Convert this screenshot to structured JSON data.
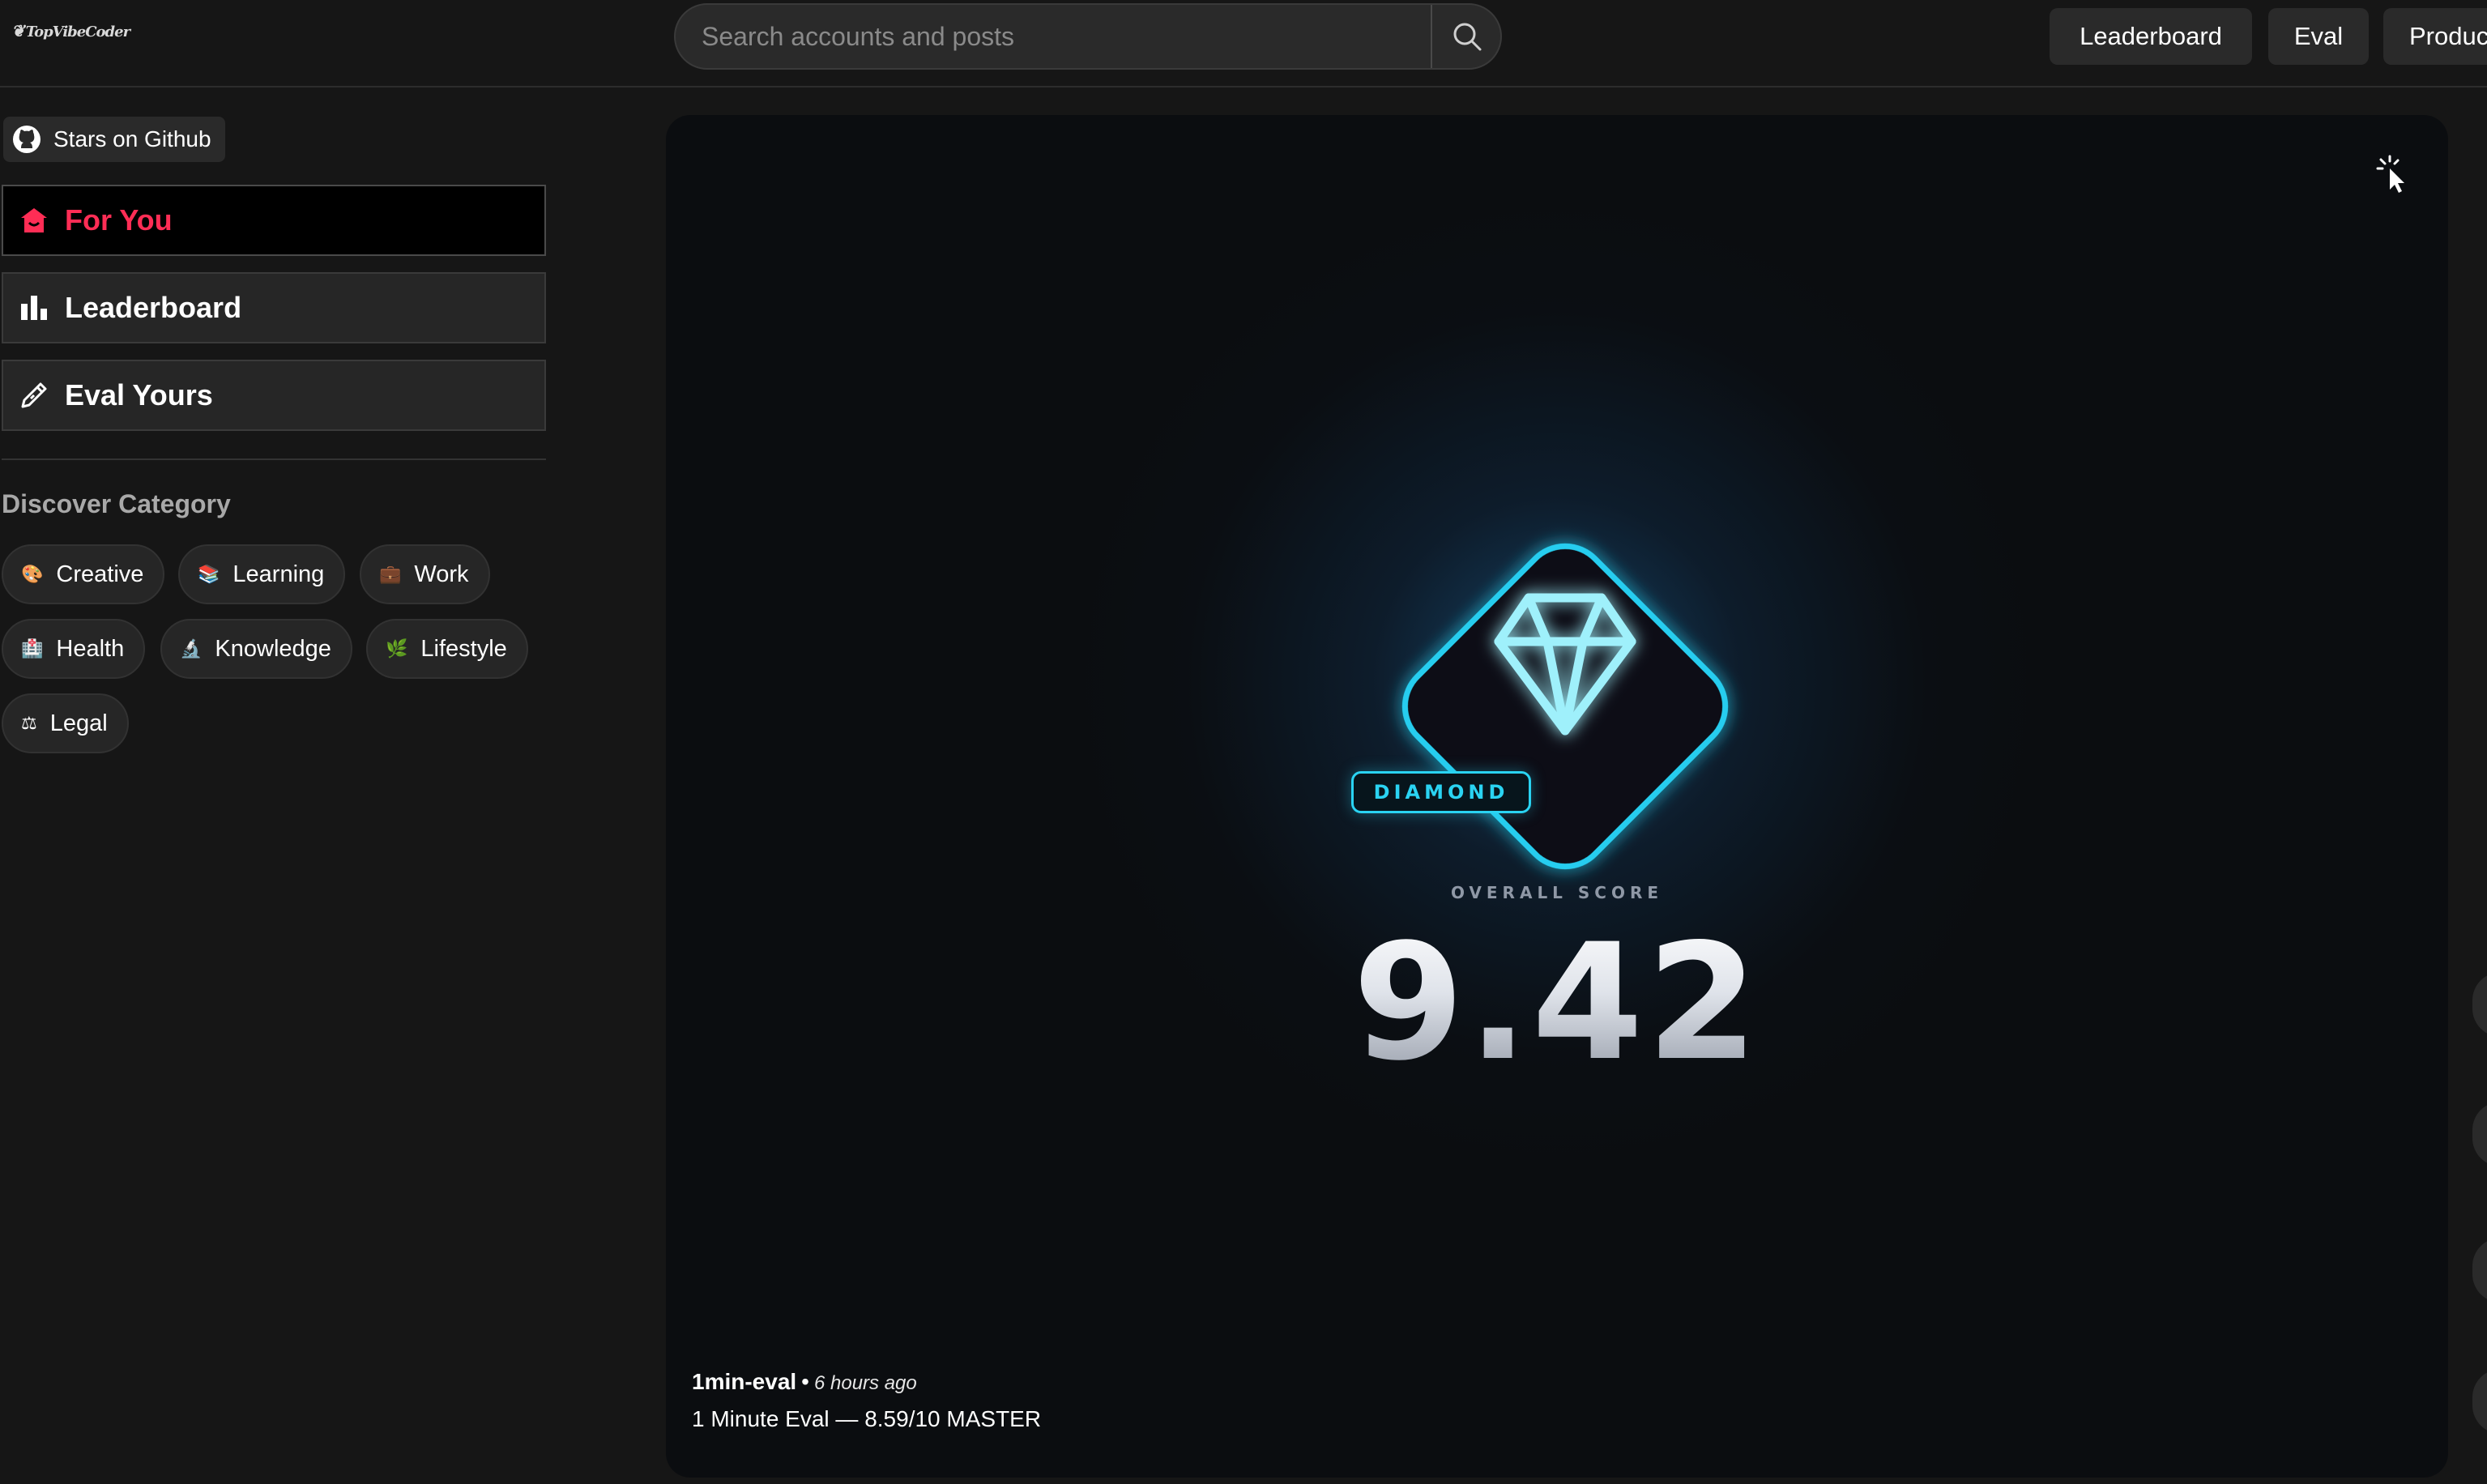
{
  "header": {
    "logo": "TopVibeCoder",
    "search_placeholder": "Search accounts and posts",
    "nav": [
      "Leaderboard",
      "Eval",
      "Produc"
    ]
  },
  "sidebar": {
    "github_label": "Stars on Github",
    "items": [
      {
        "label": "For You",
        "icon": "home-icon",
        "active": true
      },
      {
        "label": "Leaderboard",
        "icon": "bar-chart-icon",
        "active": false
      },
      {
        "label": "Eval Yours",
        "icon": "pencil-icon",
        "active": false
      }
    ],
    "discover_title": "Discover Category",
    "categories": [
      {
        "emoji": "🎨",
        "label": "Creative"
      },
      {
        "emoji": "📚",
        "label": "Learning"
      },
      {
        "emoji": "💼",
        "label": "Work"
      },
      {
        "emoji": "🏥",
        "label": "Health"
      },
      {
        "emoji": "🔬",
        "label": "Knowledge"
      },
      {
        "emoji": "🌿",
        "label": "Lifestyle"
      },
      {
        "emoji": "⚖",
        "label": "Legal"
      }
    ]
  },
  "card": {
    "tier": "DIAMOND",
    "score_caption": "OVERALL SCORE",
    "score": "9.42",
    "author": "1min-eval",
    "time_ago": "6 hours ago",
    "post_title": "1 Minute Eval — 8.59/10 MASTER"
  },
  "colors": {
    "accent_pink": "#ff2d55",
    "diamond_cyan": "#2ad3f2"
  }
}
